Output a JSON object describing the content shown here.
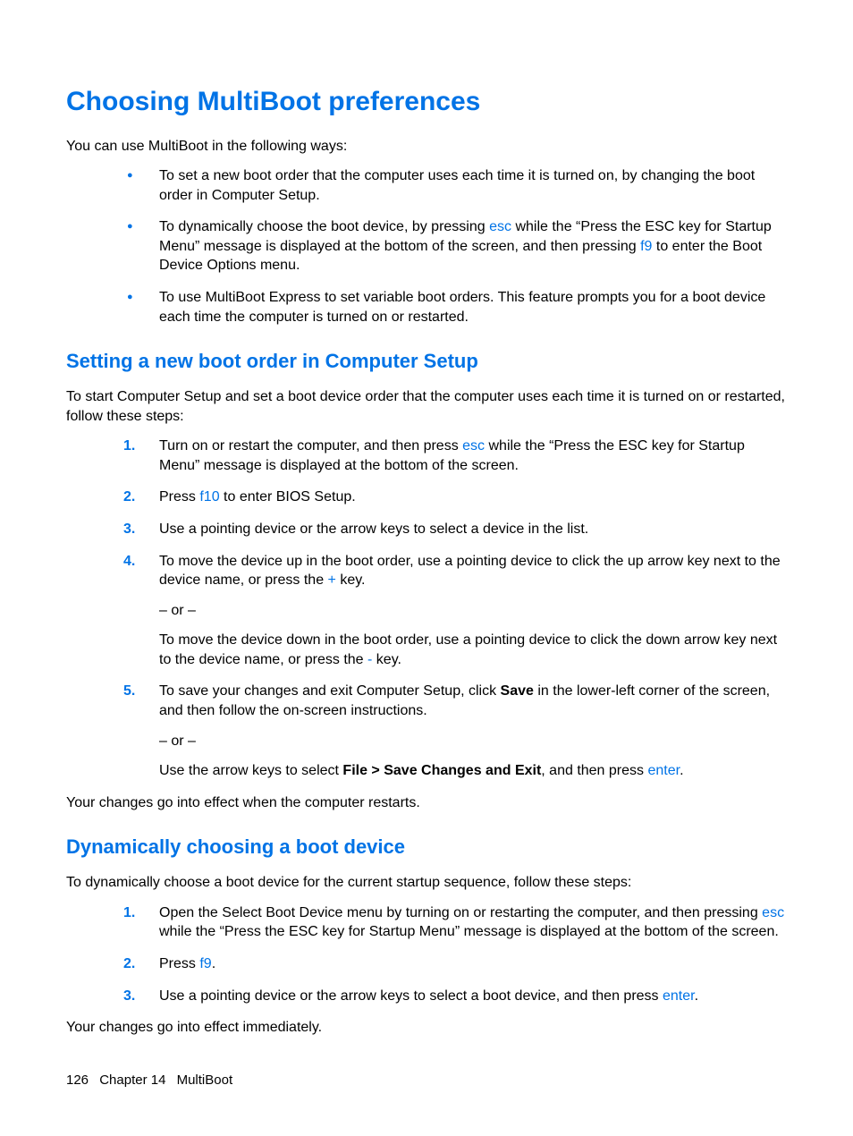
{
  "title": "Choosing MultiBoot preferences",
  "intro": "You can use MultiBoot in the following ways:",
  "bullets": [
    {
      "pre": "To set a new boot order that the computer uses each time it is turned on, by changing the boot order in Computer Setup."
    },
    {
      "pre": "To dynamically choose the boot device, by pressing ",
      "key1": "esc",
      "mid": " while the “Press the ESC key for Startup Menu” message is displayed at the bottom of the screen, and then pressing ",
      "key2": "f9",
      "post": " to enter the Boot Device Options menu."
    },
    {
      "pre": "To use MultiBoot Express to set variable boot orders. This feature prompts you for a boot device each time the computer is turned on or restarted."
    }
  ],
  "section1": {
    "title": "Setting a new boot order in Computer Setup",
    "intro": "To start Computer Setup and set a boot device order that the computer uses each time it is turned on or restarted, follow these steps:",
    "steps": {
      "s1": {
        "pre": "Turn on or restart the computer, and then press ",
        "key": "esc",
        "post": " while the “Press the ESC key for Startup Menu” message is displayed at the bottom of the screen."
      },
      "s2": {
        "pre": "Press ",
        "key": "f10",
        "post": " to enter BIOS Setup."
      },
      "s3": "Use a pointing device or the arrow keys to select a device in the list.",
      "s4": {
        "pre": "To move the device up in the boot order, use a pointing device to click the up arrow key next to the device name, or press the ",
        "key": "+",
        "post": " key.",
        "or": "– or –",
        "alt_pre": "To move the device down in the boot order, use a pointing device to click the down arrow key next to the device name, or press the ",
        "alt_key": "-",
        "alt_post": " key."
      },
      "s5": {
        "pre": "To save your changes and exit Computer Setup, click ",
        "b1": "Save",
        "mid": " in the lower-left corner of the screen, and then follow the on-screen instructions.",
        "or": "– or –",
        "alt_pre": "Use the arrow keys to select ",
        "b2": "File > Save Changes and Exit",
        "alt_mid": ", and then press ",
        "key": "enter",
        "alt_post": "."
      }
    },
    "outro": "Your changes go into effect when the computer restarts."
  },
  "section2": {
    "title": "Dynamically choosing a boot device",
    "intro": "To dynamically choose a boot device for the current startup sequence, follow these steps:",
    "steps": {
      "s1": {
        "pre": "Open the Select Boot Device menu by turning on or restarting the computer, and then pressing ",
        "key": "esc",
        "post": " while the “Press the ESC key for Startup Menu” message is displayed at the bottom of the screen."
      },
      "s2": {
        "pre": "Press ",
        "key": "f9",
        "post": "."
      },
      "s3": {
        "pre": "Use a pointing device or the arrow keys to select a boot device, and then press ",
        "key": "enter",
        "post": "."
      }
    },
    "outro": "Your changes go into effect immediately."
  },
  "footer": {
    "page": "126",
    "chapter": "Chapter 14",
    "topic": "MultiBoot"
  }
}
